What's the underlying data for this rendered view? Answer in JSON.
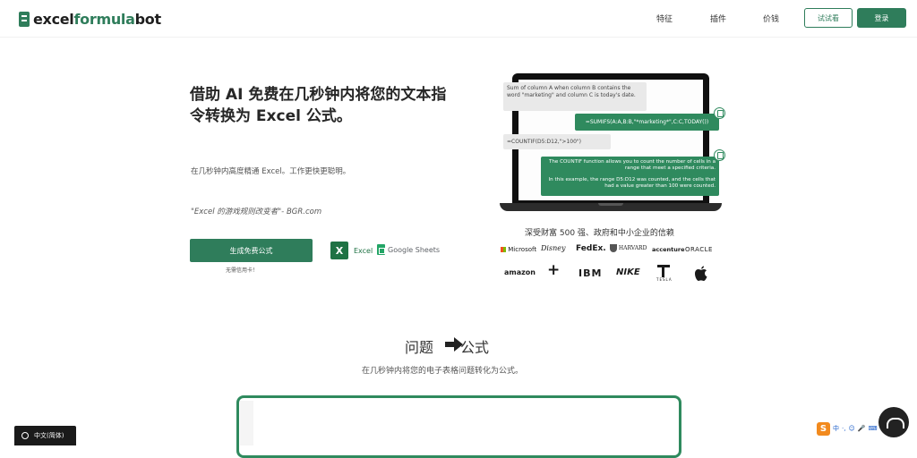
{
  "header": {
    "logo_prefix": "excel",
    "logo_accent": "formula",
    "logo_suffix": "bot",
    "nav": [
      "特征",
      "插件",
      "价钱"
    ],
    "trial_label": "试试看",
    "login_label": "登录"
  },
  "hero": {
    "title": "借助 AI 免费在几秒钟内将您的文本指令转换为 Excel 公式。",
    "subtitle": "在几秒钟内高度精通 Excel。工作更快更聪明。",
    "quote": "\"Excel 的游戏规则改变者\"- BGR.com",
    "cta_label": "生成免费公式",
    "cta_note": "无需信用卡！",
    "excel_label": "Excel",
    "sheets_label": "Google Sheets"
  },
  "demo": {
    "bubble1": "Sum of column A when column B contains the word \"marketing\" and column C is today's date.",
    "formula1": "=SUMIFS(A:A,B:B,\"*marketing*\",C:C,TODAY())",
    "formula2": "=COUNTIF(D5:D12,\">100\")",
    "explain2a": "The COUNTIF function allows you to count the number of cells in a range that meet a specified criteria.",
    "explain2b": "In this example, the range D5:D12 was counted, and the cells that had a value greater than 100 were counted."
  },
  "trust": {
    "title": "深受财富 500 强、政府和中小企业的信赖",
    "brands_row1": [
      "Microsoft",
      "Disney",
      "FedEx.",
      "HARVARD",
      "accenture",
      "ORACLE"
    ],
    "brands_row2": [
      "amazon",
      "+",
      "IBM",
      "NIKE",
      "TESLA",
      ""
    ]
  },
  "section2": {
    "title_left": "问题",
    "title_right": "公式",
    "subtitle": "在几秒钟内将您的电子表格问题转化为公式。"
  },
  "footer": {
    "lang_label": "中文(简体)",
    "ime_items": [
      "中",
      "·,",
      "☺",
      "🎤",
      "⌨",
      "👕",
      "▦"
    ]
  },
  "colors": {
    "brand_green": "#2f7d5b",
    "excel_green": "#1f7244"
  }
}
